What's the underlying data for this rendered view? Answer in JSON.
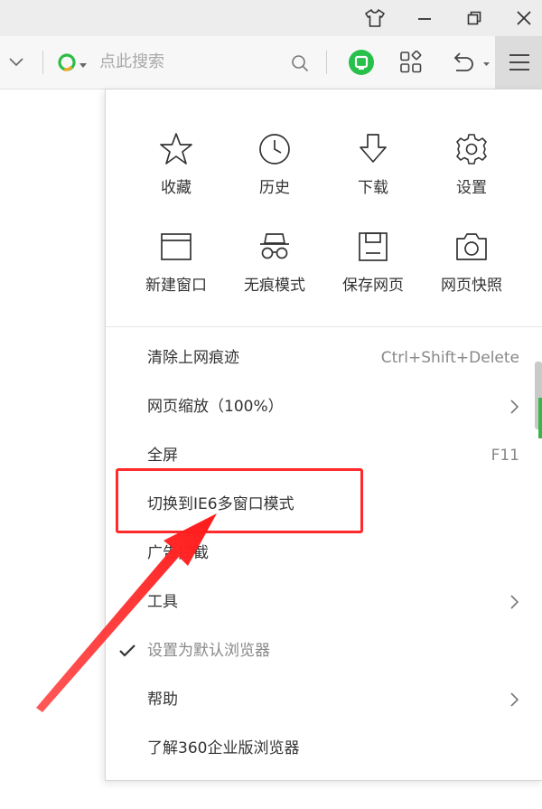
{
  "toolbar": {
    "search_placeholder": "点此搜索"
  },
  "menu": {
    "grid": [
      {
        "label": "收藏",
        "icon": "star-icon"
      },
      {
        "label": "历史",
        "icon": "clock-icon"
      },
      {
        "label": "下载",
        "icon": "download-icon"
      },
      {
        "label": "设置",
        "icon": "gear-icon"
      },
      {
        "label": "新建窗口",
        "icon": "new-window-icon"
      },
      {
        "label": "无痕模式",
        "icon": "incognito-icon"
      },
      {
        "label": "保存网页",
        "icon": "save-icon"
      },
      {
        "label": "网页快照",
        "icon": "camera-icon"
      }
    ],
    "items": [
      {
        "label": "清除上网痕迹",
        "shortcut": "Ctrl+Shift+Delete"
      },
      {
        "label": "网页缩放（100%）",
        "has_submenu": true
      },
      {
        "label": "全屏",
        "shortcut": "F11"
      },
      {
        "label": "切换到IE6多窗口模式"
      },
      {
        "label": "广告拦截"
      },
      {
        "label": "工具",
        "has_submenu": true
      },
      {
        "label": "设置为默认浏览器",
        "checked": true
      },
      {
        "label": "帮助",
        "has_submenu": true
      },
      {
        "label": "了解360企业版浏览器"
      }
    ]
  },
  "colors": {
    "annotation_red": "#ff2a2a",
    "green_accent": "#27c04a",
    "search_logo_green": "#2cbd45",
    "search_logo_orange": "#f5a623"
  }
}
